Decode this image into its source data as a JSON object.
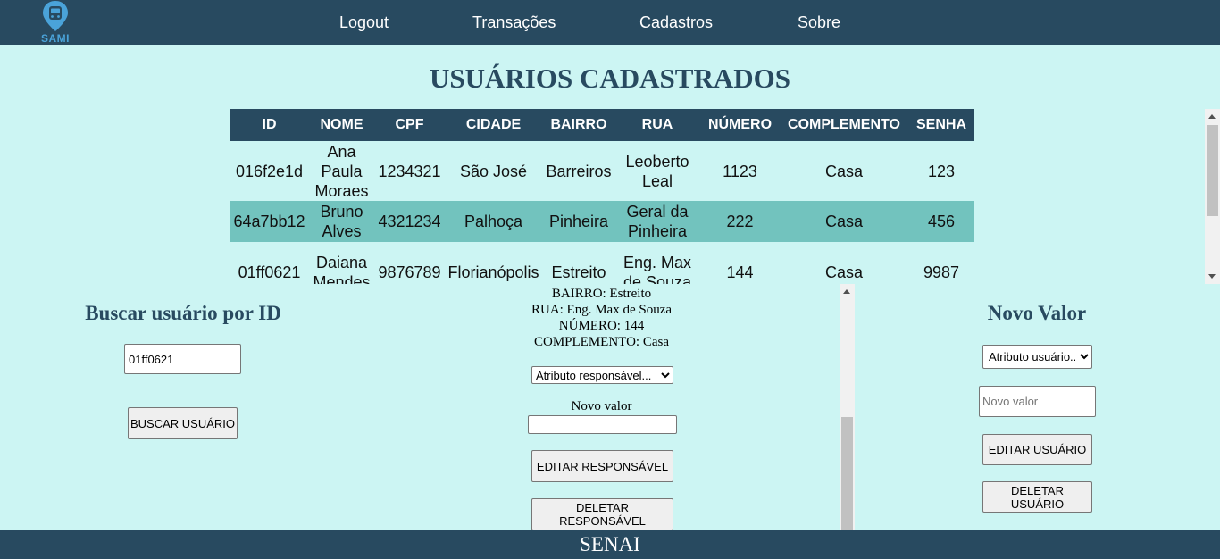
{
  "header": {
    "logo_text": "SAMI",
    "nav": [
      "Logout",
      "Transações",
      "Cadastros",
      "Sobre"
    ]
  },
  "page_title": "USUÁRIOS CADASTRADOS",
  "table": {
    "columns": [
      "ID",
      "NOME",
      "CPF",
      "CIDADE",
      "BAIRRO",
      "RUA",
      "NÚMERO",
      "COMPLEMENTO",
      "SENHA"
    ],
    "rows": [
      [
        "016f2e1d",
        "Ana Paula Moraes",
        "1234321",
        "São José",
        "Barreiros",
        "Leoberto Leal",
        "1123",
        "Casa",
        "123"
      ],
      [
        "64a7bb12",
        "Bruno Alves",
        "4321234",
        "Palhoça",
        "Pinheira",
        "Geral da Pinheira",
        "222",
        "Casa",
        "456"
      ],
      [
        "01ff0621",
        "Daiana Mendes",
        "9876789",
        "Florianópolis",
        "Estreito",
        "Eng. Max de Souza",
        "144",
        "Casa",
        "9987"
      ]
    ]
  },
  "search": {
    "title": "Buscar usuário por ID",
    "input_value": "01ff0621",
    "button_label": "BUSCAR USUÁRIO"
  },
  "details": {
    "lines": [
      "BAIRRO: Estreito",
      "RUA: Eng. Max de Souza",
      "NÚMERO: 144",
      "COMPLEMENTO: Casa"
    ],
    "select_selected": "Atributo responsável...",
    "new_value_label": "Novo valor",
    "new_value_input": "",
    "edit_button": "EDITAR RESPONSÁVEL",
    "delete_button": "DELETAR RESPONSÁVEL"
  },
  "new_value_panel": {
    "title": "Novo Valor",
    "select_selected": "Atributo usuário...",
    "input_placeholder": "Novo valor",
    "edit_button": "EDITAR USUÁRIO",
    "delete_button": "DELETAR USUÁRIO"
  },
  "footer": {
    "text": "SENAI"
  },
  "colors": {
    "primary": "#284a60",
    "background": "#ccf5f3",
    "highlight_row": "#72c3be",
    "logo": "#4aa3d9"
  },
  "icons": {
    "logo": "bus-pin-icon"
  }
}
